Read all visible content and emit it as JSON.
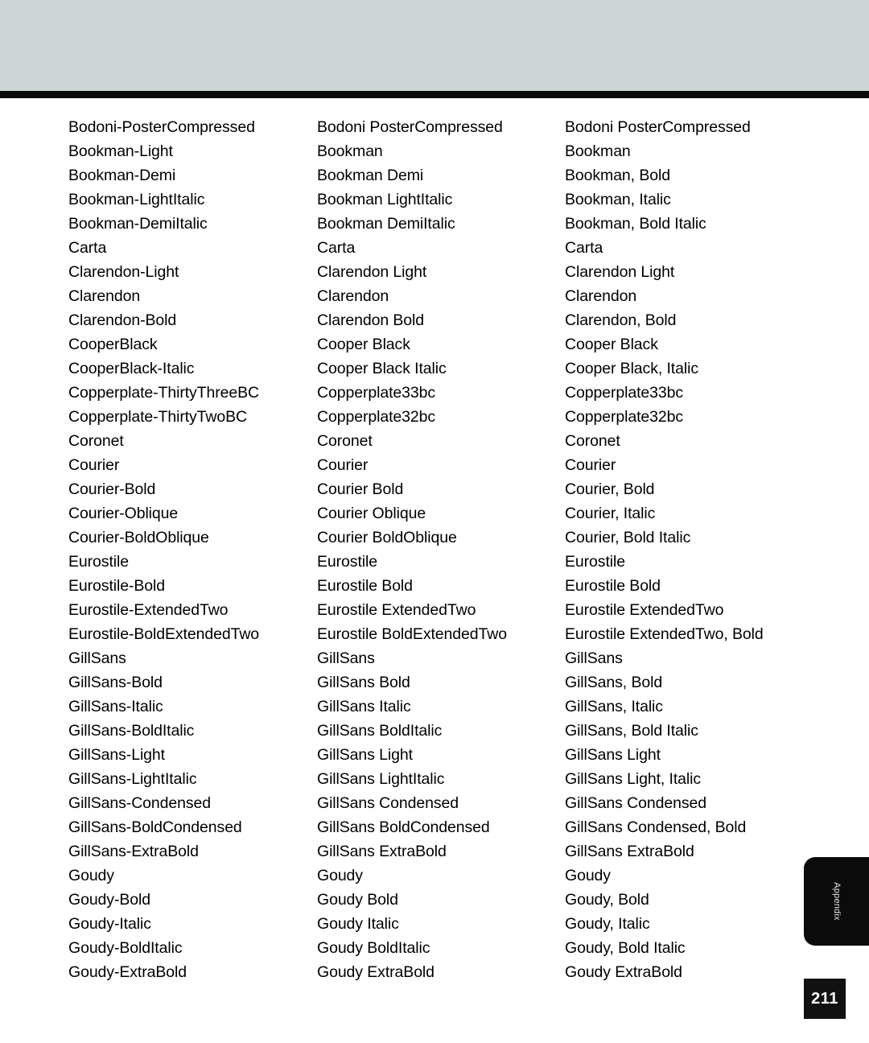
{
  "page": {
    "number": "211",
    "side_tab_label": "Appendix",
    "header_band_color": "#ced5d5",
    "header_rule_color": "#0a0a0a",
    "tab_color": "#0b0b0b",
    "page_number_box_color": "#111111",
    "text_color": "#000000"
  },
  "font_table": {
    "rows": [
      [
        "Bodoni-PosterCompressed",
        "Bodoni PosterCompressed",
        "Bodoni PosterCompressed"
      ],
      [
        "Bookman-Light",
        "Bookman",
        "Bookman"
      ],
      [
        "Bookman-Demi",
        "Bookman Demi",
        "Bookman, Bold"
      ],
      [
        "Bookman-LightItalic",
        "Bookman LightItalic",
        "Bookman, Italic"
      ],
      [
        "Bookman-DemiItalic",
        "Bookman DemiItalic",
        "Bookman, Bold Italic"
      ],
      [
        "Carta",
        "Carta",
        "Carta"
      ],
      [
        "Clarendon-Light",
        "Clarendon Light",
        "Clarendon Light"
      ],
      [
        "Clarendon",
        "Clarendon",
        "Clarendon"
      ],
      [
        "Clarendon-Bold",
        "Clarendon Bold",
        "Clarendon, Bold"
      ],
      [
        "CooperBlack",
        "Cooper Black",
        "Cooper Black"
      ],
      [
        "CooperBlack-Italic",
        "Cooper Black Italic",
        "Cooper Black, Italic"
      ],
      [
        "Copperplate-ThirtyThreeBC",
        "Copperplate33bc",
        "Copperplate33bc"
      ],
      [
        "Copperplate-ThirtyTwoBC",
        "Copperplate32bc",
        "Copperplate32bc"
      ],
      [
        "Coronet",
        "Coronet",
        "Coronet"
      ],
      [
        "Courier",
        "Courier",
        "Courier"
      ],
      [
        "Courier-Bold",
        "Courier Bold",
        "Courier, Bold"
      ],
      [
        "Courier-Oblique",
        "Courier Oblique",
        "Courier, Italic"
      ],
      [
        "Courier-BoldOblique",
        "Courier BoldOblique",
        "Courier, Bold Italic"
      ],
      [
        "Eurostile",
        "Eurostile",
        "Eurostile"
      ],
      [
        "Eurostile-Bold",
        "Eurostile Bold",
        "Eurostile Bold"
      ],
      [
        "Eurostile-ExtendedTwo",
        "Eurostile ExtendedTwo",
        "Eurostile ExtendedTwo"
      ],
      [
        "Eurostile-BoldExtendedTwo",
        "Eurostile BoldExtendedTwo",
        "Eurostile ExtendedTwo, Bold"
      ],
      [
        "GillSans",
        "GillSans",
        "GillSans"
      ],
      [
        "GillSans-Bold",
        "GillSans Bold",
        "GillSans, Bold"
      ],
      [
        "GillSans-Italic",
        "GillSans Italic",
        "GillSans, Italic"
      ],
      [
        "GillSans-BoldItalic",
        "GillSans BoldItalic",
        "GillSans, Bold Italic"
      ],
      [
        "GillSans-Light",
        "GillSans Light",
        "GillSans Light"
      ],
      [
        "GillSans-LightItalic",
        "GillSans LightItalic",
        "GillSans Light, Italic"
      ],
      [
        "GillSans-Condensed",
        "GillSans Condensed",
        "GillSans Condensed"
      ],
      [
        "GillSans-BoldCondensed",
        "GillSans BoldCondensed",
        "GillSans Condensed, Bold"
      ],
      [
        "GillSans-ExtraBold",
        "GillSans ExtraBold",
        "GillSans ExtraBold"
      ],
      [
        "Goudy",
        "Goudy",
        "Goudy"
      ],
      [
        "Goudy-Bold",
        "Goudy Bold",
        "Goudy, Bold"
      ],
      [
        "Goudy-Italic",
        "Goudy Italic",
        "Goudy, Italic"
      ],
      [
        "Goudy-BoldItalic",
        "Goudy BoldItalic",
        "Goudy, Bold Italic"
      ],
      [
        "Goudy-ExtraBold",
        "Goudy ExtraBold",
        "Goudy ExtraBold"
      ]
    ]
  }
}
